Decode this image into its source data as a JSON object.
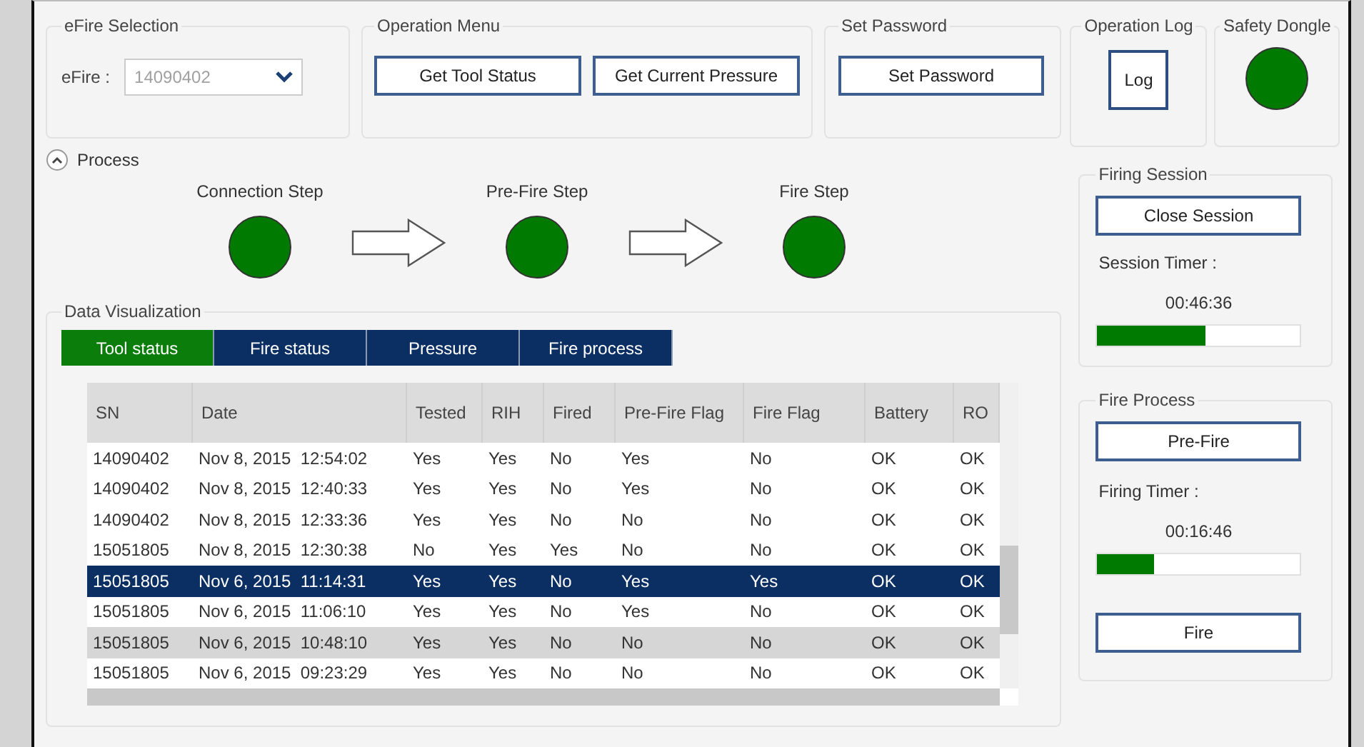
{
  "efire_selection": {
    "title": "eFire Selection",
    "label": "eFire :",
    "value": "14090402",
    "disabled": true
  },
  "operation_menu": {
    "title": "Operation Menu",
    "buttons": [
      "Get Tool Status",
      "Get Current Pressure"
    ]
  },
  "set_password": {
    "title": "Set Password",
    "button": "Set Password"
  },
  "operation_log": {
    "title": "Operation Log",
    "button": "Log"
  },
  "safety_dongle": {
    "title": "Safety Dongle",
    "on": true
  },
  "process": {
    "title": "Process",
    "expanded": true,
    "steps": [
      {
        "label": "Connection Step",
        "on": true
      },
      {
        "label": "Pre-Fire Step",
        "on": true
      },
      {
        "label": "Fire Step",
        "on": true
      }
    ]
  },
  "firing_session": {
    "title": "Firing Session",
    "button": "Close Session",
    "timer_label": "Session Timer :",
    "timer": "00:46:36",
    "level": 0.53
  },
  "fire_process": {
    "title": "Fire Process",
    "button": "Pre-Fire",
    "timer_label": "Firing Timer :",
    "timer": "00:16:46",
    "level": 0.28,
    "fire_button": "Fire"
  },
  "data_visualization": {
    "title": "Data Visualization",
    "tabs": [
      {
        "label": "Tool status",
        "selected": true
      },
      {
        "label": "Fire status",
        "selected": false
      },
      {
        "label": "Pressure",
        "selected": false
      },
      {
        "label": "Fire process",
        "selected": false
      }
    ],
    "table": {
      "columns": [
        "SN",
        "Date",
        "Tested",
        "RIH",
        "Fired",
        "Pre-Fire Flag",
        "Fire Flag",
        "Battery",
        "RO"
      ],
      "rows": [
        {
          "cells": [
            "14090402",
            "Nov 8, 2015  12:54:02",
            "Yes",
            "Yes",
            "No",
            "Yes",
            "No",
            "OK",
            "OK"
          ],
          "selected": false,
          "highlighted": false
        },
        {
          "cells": [
            "14090402",
            "Nov 8, 2015  12:40:33",
            "Yes",
            "Yes",
            "No",
            "Yes",
            "No",
            "OK",
            "OK"
          ],
          "selected": false,
          "highlighted": false
        },
        {
          "cells": [
            "14090402",
            "Nov 8, 2015  12:33:36",
            "Yes",
            "Yes",
            "No",
            "No",
            "No",
            "OK",
            "OK"
          ],
          "selected": false,
          "highlighted": false
        },
        {
          "cells": [
            "15051805",
            "Nov 8, 2015  12:30:38",
            "No",
            "Yes",
            "Yes",
            "No",
            "No",
            "OK",
            "OK"
          ],
          "selected": false,
          "highlighted": false
        },
        {
          "cells": [
            "15051805",
            "Nov 6, 2015  11:14:31",
            "Yes",
            "Yes",
            "No",
            "Yes",
            "Yes",
            "OK",
            "OK"
          ],
          "selected": true,
          "highlighted": false
        },
        {
          "cells": [
            "15051805",
            "Nov 6, 2015  11:06:10",
            "Yes",
            "Yes",
            "No",
            "Yes",
            "No",
            "OK",
            "OK"
          ],
          "selected": false,
          "highlighted": false
        },
        {
          "cells": [
            "15051805",
            "Nov 6, 2015  10:48:10",
            "Yes",
            "Yes",
            "No",
            "No",
            "No",
            "OK",
            "OK"
          ],
          "selected": false,
          "highlighted": true
        },
        {
          "cells": [
            "15051805",
            "Nov 6, 2015  09:23:29",
            "Yes",
            "Yes",
            "No",
            "No",
            "No",
            "OK",
            "OK"
          ],
          "selected": false,
          "highlighted": false
        }
      ]
    }
  }
}
